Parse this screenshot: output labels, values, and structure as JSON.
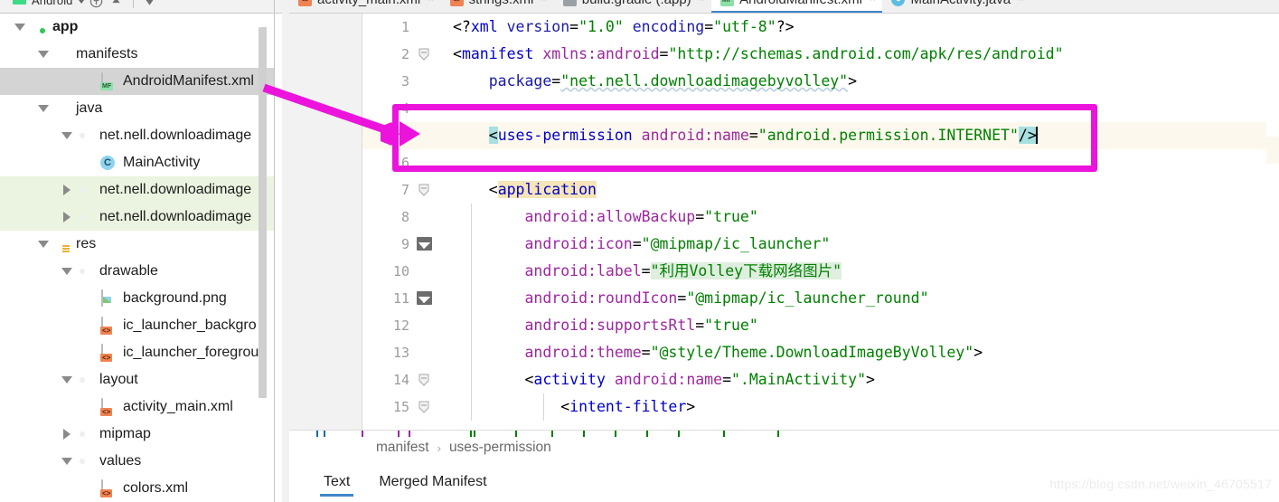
{
  "toolbar": {
    "module_selector": "Android",
    "icons": [
      "anchor-icon",
      "up-arrow-icon",
      "separator",
      "down-arrow-icon"
    ]
  },
  "project_tree": {
    "items": [
      {
        "label": "app",
        "indent": 0,
        "arrow": "down",
        "icon": "module-folder-icon",
        "state": "normal",
        "bold": true
      },
      {
        "label": "manifests",
        "indent": 1,
        "arrow": "down",
        "icon": "blue-folder-icon",
        "state": "normal",
        "bold": false
      },
      {
        "label": "AndroidManifest.xml",
        "indent": 3,
        "arrow": "none",
        "icon": "manifest-file-icon",
        "state": "selected",
        "bold": false
      },
      {
        "label": "java",
        "indent": 1,
        "arrow": "down",
        "icon": "blue-folder-icon",
        "state": "normal",
        "bold": false
      },
      {
        "label": "net.nell.downloadimage",
        "indent": 2,
        "arrow": "down",
        "icon": "package-icon",
        "state": "normal",
        "bold": false
      },
      {
        "label": "MainActivity",
        "indent": 3,
        "arrow": "none",
        "icon": "java-class-icon",
        "state": "normal",
        "bold": false
      },
      {
        "label": "net.nell.downloadimage",
        "indent": 2,
        "arrow": "right",
        "icon": "package-icon",
        "state": "green",
        "bold": false
      },
      {
        "label": "net.nell.downloadimage",
        "indent": 2,
        "arrow": "right",
        "icon": "package-icon",
        "state": "green",
        "bold": false
      },
      {
        "label": "res",
        "indent": 1,
        "arrow": "down",
        "icon": "res-folder-icon",
        "state": "normal",
        "bold": false
      },
      {
        "label": "drawable",
        "indent": 2,
        "arrow": "down",
        "icon": "package-icon",
        "state": "normal",
        "bold": false
      },
      {
        "label": "background.png",
        "indent": 3,
        "arrow": "none",
        "icon": "image-file-icon",
        "state": "normal",
        "bold": false
      },
      {
        "label": "ic_launcher_backgro",
        "indent": 3,
        "arrow": "none",
        "icon": "xml-file-icon",
        "state": "normal",
        "bold": false
      },
      {
        "label": "ic_launcher_foregrou",
        "indent": 3,
        "arrow": "none",
        "icon": "xml-file-icon",
        "state": "normal",
        "bold": false
      },
      {
        "label": "layout",
        "indent": 2,
        "arrow": "down",
        "icon": "package-icon",
        "state": "normal",
        "bold": false
      },
      {
        "label": "activity_main.xml",
        "indent": 3,
        "arrow": "none",
        "icon": "xml-file-icon",
        "state": "normal",
        "bold": false
      },
      {
        "label": "mipmap",
        "indent": 2,
        "arrow": "right",
        "icon": "package-icon",
        "state": "normal",
        "bold": false
      },
      {
        "label": "values",
        "indent": 2,
        "arrow": "down",
        "icon": "package-icon",
        "state": "normal",
        "bold": false
      },
      {
        "label": "colors.xml",
        "indent": 3,
        "arrow": "none",
        "icon": "xml-file-icon",
        "state": "normal",
        "bold": false
      }
    ]
  },
  "editor_tabs": [
    {
      "label": "activity_main.xml",
      "icon": "xml-file-icon",
      "active": false
    },
    {
      "label": "strings.xml",
      "icon": "xml-file-icon",
      "active": false
    },
    {
      "label": "build.gradle (:app)",
      "icon": "gradle-file-icon",
      "active": false
    },
    {
      "label": "AndroidManifest.xml",
      "icon": "manifest-file-icon",
      "active": true
    },
    {
      "label": "MainActivity.java",
      "icon": "java-file-icon",
      "active": false
    }
  ],
  "code": {
    "lines": [
      {
        "no": "1",
        "gutter": "",
        "current": false,
        "tokens": [
          {
            "text": "<?",
            "cls": "t-punct"
          },
          {
            "text": "xml",
            "cls": "t-pi"
          },
          {
            "text": " ",
            "cls": "t-punct"
          },
          {
            "text": "version",
            "cls": "t-name"
          },
          {
            "text": "=",
            "cls": "t-punct"
          },
          {
            "text": "\"1.0\"",
            "cls": "t-val"
          },
          {
            "text": " ",
            "cls": "t-punct"
          },
          {
            "text": "encoding",
            "cls": "t-name"
          },
          {
            "text": "=",
            "cls": "t-punct"
          },
          {
            "text": "\"utf-8\"",
            "cls": "t-val"
          },
          {
            "text": "?>",
            "cls": "t-punct"
          }
        ],
        "indent": 0
      },
      {
        "no": "2",
        "gutter": "fold",
        "current": false,
        "tokens": [
          {
            "text": "<",
            "cls": "t-punct"
          },
          {
            "text": "manifest",
            "cls": "t-tag"
          },
          {
            "text": " ",
            "cls": "t-punct"
          },
          {
            "text": "xmlns:android",
            "cls": "t-attr"
          },
          {
            "text": "=",
            "cls": "t-punct"
          },
          {
            "text": "\"http://schemas.android.com/apk/res/android\"",
            "cls": "t-val"
          }
        ],
        "indent": 0
      },
      {
        "no": "3",
        "gutter": "",
        "current": false,
        "tokens": [
          {
            "text": "    ",
            "cls": "t-punct"
          },
          {
            "text": "package",
            "cls": "t-name"
          },
          {
            "text": "=",
            "cls": "t-punct"
          },
          {
            "text": "\"net.nell.downloadimagebyvolley\"",
            "cls": "t-val squiggle"
          },
          {
            "text": ">",
            "cls": "t-punct"
          }
        ],
        "indent": 0
      },
      {
        "no": "4",
        "gutter": "",
        "current": false,
        "tokens": [],
        "indent": 0
      },
      {
        "no": "5",
        "gutter": "",
        "current": true,
        "tokens": [
          {
            "text": "    ",
            "cls": "t-punct"
          },
          {
            "text": "<",
            "cls": "t-punct hl-bracket"
          },
          {
            "text": "uses-permission",
            "cls": "t-tag"
          },
          {
            "text": " ",
            "cls": "t-punct"
          },
          {
            "text": "android:name",
            "cls": "t-attr"
          },
          {
            "text": "=",
            "cls": "t-punct"
          },
          {
            "text": "\"android.permission.INTERNET\"",
            "cls": "t-val"
          },
          {
            "text": "/>",
            "cls": "t-punct hl-bracket"
          },
          {
            "text": "|CARET|",
            "cls": "caret-token"
          }
        ],
        "indent": 0
      },
      {
        "no": "6",
        "gutter": "",
        "current": false,
        "tokens": [],
        "indent": 0
      },
      {
        "no": "7",
        "gutter": "fold",
        "current": false,
        "tokens": [
          {
            "text": "    ",
            "cls": "t-punct"
          },
          {
            "text": "<",
            "cls": "t-punct"
          },
          {
            "text": "application",
            "cls": "t-tag hl-tan"
          }
        ],
        "indent": 0
      },
      {
        "no": "8",
        "gutter": "",
        "current": false,
        "tokens": [
          {
            "text": "        ",
            "cls": "t-punct"
          },
          {
            "text": "android:allowBackup",
            "cls": "t-attr"
          },
          {
            "text": "=",
            "cls": "t-punct"
          },
          {
            "text": "\"true\"",
            "cls": "t-val"
          }
        ],
        "indent": 1
      },
      {
        "no": "9",
        "gutter": "image",
        "current": false,
        "tokens": [
          {
            "text": "        ",
            "cls": "t-punct"
          },
          {
            "text": "android:icon",
            "cls": "t-attr"
          },
          {
            "text": "=",
            "cls": "t-punct"
          },
          {
            "text": "\"@mipmap/ic_launcher\"",
            "cls": "t-val"
          }
        ],
        "indent": 1
      },
      {
        "no": "10",
        "gutter": "",
        "current": false,
        "tokens": [
          {
            "text": "        ",
            "cls": "t-punct"
          },
          {
            "text": "android:label",
            "cls": "t-attr"
          },
          {
            "text": "=",
            "cls": "t-punct"
          },
          {
            "text": "\"利用Volley下载网络图片\"",
            "cls": "t-val hl-green"
          }
        ],
        "indent": 1
      },
      {
        "no": "11",
        "gutter": "image",
        "current": false,
        "tokens": [
          {
            "text": "        ",
            "cls": "t-punct"
          },
          {
            "text": "android:roundIcon",
            "cls": "t-attr"
          },
          {
            "text": "=",
            "cls": "t-punct"
          },
          {
            "text": "\"@mipmap/ic_launcher_round\"",
            "cls": "t-val"
          }
        ],
        "indent": 1
      },
      {
        "no": "12",
        "gutter": "",
        "current": false,
        "tokens": [
          {
            "text": "        ",
            "cls": "t-punct"
          },
          {
            "text": "android:supportsRtl",
            "cls": "t-attr"
          },
          {
            "text": "=",
            "cls": "t-punct"
          },
          {
            "text": "\"true\"",
            "cls": "t-val"
          }
        ],
        "indent": 1
      },
      {
        "no": "13",
        "gutter": "",
        "current": false,
        "tokens": [
          {
            "text": "        ",
            "cls": "t-punct"
          },
          {
            "text": "android:theme",
            "cls": "t-attr"
          },
          {
            "text": "=",
            "cls": "t-punct"
          },
          {
            "text": "\"@style/Theme.DownloadImageByVolley\"",
            "cls": "t-val"
          },
          {
            "text": ">",
            "cls": "t-punct"
          }
        ],
        "indent": 1
      },
      {
        "no": "14",
        "gutter": "fold",
        "current": false,
        "tokens": [
          {
            "text": "        ",
            "cls": "t-punct"
          },
          {
            "text": "<",
            "cls": "t-punct"
          },
          {
            "text": "activity",
            "cls": "t-tag"
          },
          {
            "text": " ",
            "cls": "t-punct"
          },
          {
            "text": "android:name",
            "cls": "t-attr"
          },
          {
            "text": "=",
            "cls": "t-punct"
          },
          {
            "text": "\".MainActivity\"",
            "cls": "t-val"
          },
          {
            "text": ">",
            "cls": "t-punct"
          }
        ],
        "indent": 1
      },
      {
        "no": "15",
        "gutter": "fold",
        "current": false,
        "tokens": [
          {
            "text": "            ",
            "cls": "t-punct"
          },
          {
            "text": "<",
            "cls": "t-punct"
          },
          {
            "text": "intent-filter",
            "cls": "t-tag"
          },
          {
            "text": ">",
            "cls": "t-punct"
          }
        ],
        "indent": 2
      }
    ]
  },
  "breadcrumb": {
    "root": "manifest",
    "separator": "›",
    "current": "uses-permission"
  },
  "bottom_tabs": [
    {
      "label": "Text",
      "active": true
    },
    {
      "label": "Merged Manifest",
      "active": false
    }
  ],
  "annotation": {
    "highlight_color": "#ec13dc",
    "target_line": "5",
    "source": "AndroidManifest.xml"
  },
  "watermark": "https://blog.csdn.net/weixin_46705517",
  "colors": {
    "selection": "#d4d4d4",
    "current_line": "#fdf8ed",
    "tab_underline": "#3f86c9",
    "bracket_match": "#a6e0e0"
  }
}
